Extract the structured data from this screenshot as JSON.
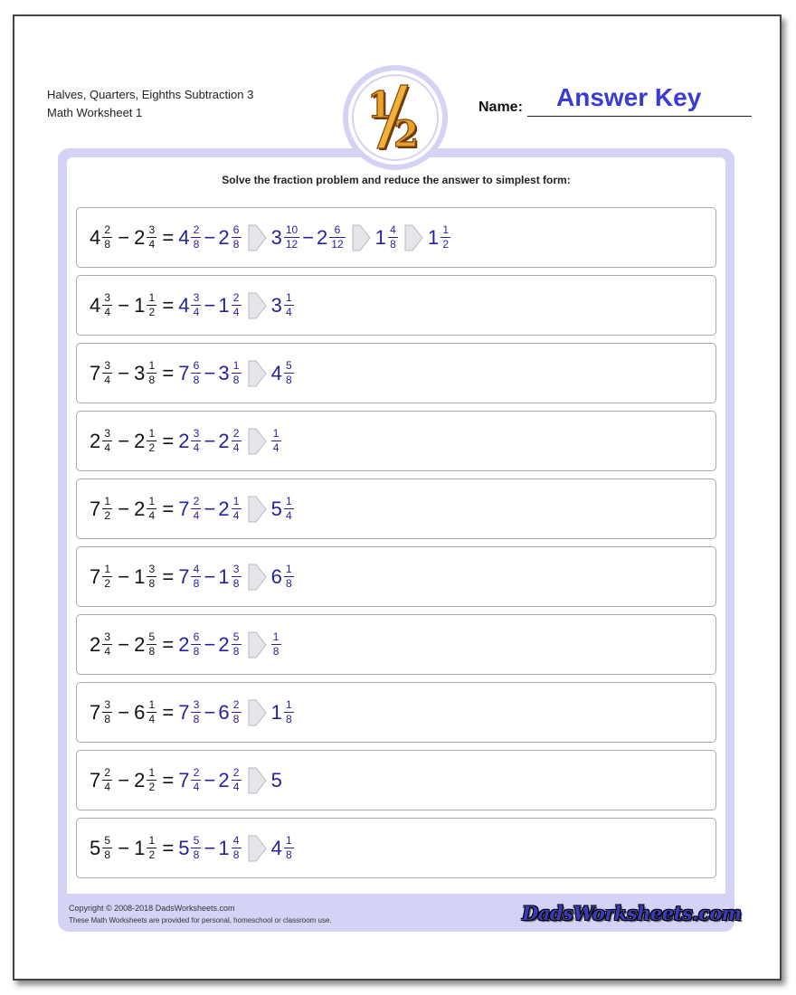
{
  "header": {
    "title_line1": "Halves, Quarters, Eighths Subtraction 3",
    "title_line2": "Math Worksheet 1",
    "name_label": "Name:",
    "name_value": "Answer Key",
    "logo_icon": "one-half-fraction-icon"
  },
  "instructions": "Solve the fraction problem and reduce the answer to simplest form:",
  "colors": {
    "question": "#111111",
    "answer": "#25219e",
    "frame": "#d5d3f5",
    "answer_key": "#3a3ad6"
  },
  "problems": [
    {
      "q1": {
        "w": "4",
        "n": "2",
        "d": "8"
      },
      "q2": {
        "w": "2",
        "n": "3",
        "d": "4"
      },
      "steps": [
        [
          {
            "w": "4",
            "n": "2",
            "d": "8"
          },
          {
            "w": "2",
            "n": "6",
            "d": "8"
          }
        ],
        [
          {
            "w": "3",
            "n": "10",
            "d": "12"
          },
          {
            "w": "2",
            "n": "6",
            "d": "12"
          }
        ],
        [
          {
            "w": "1",
            "n": "4",
            "d": "8"
          }
        ],
        [
          {
            "w": "1",
            "n": "1",
            "d": "2"
          }
        ]
      ]
    },
    {
      "q1": {
        "w": "4",
        "n": "3",
        "d": "4"
      },
      "q2": {
        "w": "1",
        "n": "1",
        "d": "2"
      },
      "steps": [
        [
          {
            "w": "4",
            "n": "3",
            "d": "4"
          },
          {
            "w": "1",
            "n": "2",
            "d": "4"
          }
        ],
        [
          {
            "w": "3",
            "n": "1",
            "d": "4"
          }
        ]
      ]
    },
    {
      "q1": {
        "w": "7",
        "n": "3",
        "d": "4"
      },
      "q2": {
        "w": "3",
        "n": "1",
        "d": "8"
      },
      "steps": [
        [
          {
            "w": "7",
            "n": "6",
            "d": "8"
          },
          {
            "w": "3",
            "n": "1",
            "d": "8"
          }
        ],
        [
          {
            "w": "4",
            "n": "5",
            "d": "8"
          }
        ]
      ]
    },
    {
      "q1": {
        "w": "2",
        "n": "3",
        "d": "4"
      },
      "q2": {
        "w": "2",
        "n": "1",
        "d": "2"
      },
      "steps": [
        [
          {
            "w": "2",
            "n": "3",
            "d": "4"
          },
          {
            "w": "2",
            "n": "2",
            "d": "4"
          }
        ],
        [
          {
            "w": "",
            "n": "1",
            "d": "4"
          }
        ]
      ]
    },
    {
      "q1": {
        "w": "7",
        "n": "1",
        "d": "2"
      },
      "q2": {
        "w": "2",
        "n": "1",
        "d": "4"
      },
      "steps": [
        [
          {
            "w": "7",
            "n": "2",
            "d": "4"
          },
          {
            "w": "2",
            "n": "1",
            "d": "4"
          }
        ],
        [
          {
            "w": "5",
            "n": "1",
            "d": "4"
          }
        ]
      ]
    },
    {
      "q1": {
        "w": "7",
        "n": "1",
        "d": "2"
      },
      "q2": {
        "w": "1",
        "n": "3",
        "d": "8"
      },
      "steps": [
        [
          {
            "w": "7",
            "n": "4",
            "d": "8"
          },
          {
            "w": "1",
            "n": "3",
            "d": "8"
          }
        ],
        [
          {
            "w": "6",
            "n": "1",
            "d": "8"
          }
        ]
      ]
    },
    {
      "q1": {
        "w": "2",
        "n": "3",
        "d": "4"
      },
      "q2": {
        "w": "2",
        "n": "5",
        "d": "8"
      },
      "steps": [
        [
          {
            "w": "2",
            "n": "6",
            "d": "8"
          },
          {
            "w": "2",
            "n": "5",
            "d": "8"
          }
        ],
        [
          {
            "w": "",
            "n": "1",
            "d": "8"
          }
        ]
      ]
    },
    {
      "q1": {
        "w": "7",
        "n": "3",
        "d": "8"
      },
      "q2": {
        "w": "6",
        "n": "1",
        "d": "4"
      },
      "steps": [
        [
          {
            "w": "7",
            "n": "3",
            "d": "8"
          },
          {
            "w": "6",
            "n": "2",
            "d": "8"
          }
        ],
        [
          {
            "w": "1",
            "n": "1",
            "d": "8"
          }
        ]
      ]
    },
    {
      "q1": {
        "w": "7",
        "n": "2",
        "d": "4"
      },
      "q2": {
        "w": "2",
        "n": "1",
        "d": "2"
      },
      "steps": [
        [
          {
            "w": "7",
            "n": "2",
            "d": "4"
          },
          {
            "w": "2",
            "n": "2",
            "d": "4"
          }
        ],
        [
          {
            "w": "5",
            "n": "",
            "d": ""
          }
        ]
      ]
    },
    {
      "q1": {
        "w": "5",
        "n": "5",
        "d": "8"
      },
      "q2": {
        "w": "1",
        "n": "1",
        "d": "2"
      },
      "steps": [
        [
          {
            "w": "5",
            "n": "5",
            "d": "8"
          },
          {
            "w": "1",
            "n": "4",
            "d": "8"
          }
        ],
        [
          {
            "w": "4",
            "n": "1",
            "d": "8"
          }
        ]
      ]
    }
  ],
  "symbols": {
    "minus": "−",
    "equals": "=",
    "arrow_icon": "chevron-right-arrow-icon"
  },
  "footer": {
    "copyright": "Copyright © 2008-2018 DadsWorksheets.com",
    "notice": "These Math Worksheets are provided for personal, homeschool or classroom use.",
    "brand": "DadsWorksheets.com"
  }
}
